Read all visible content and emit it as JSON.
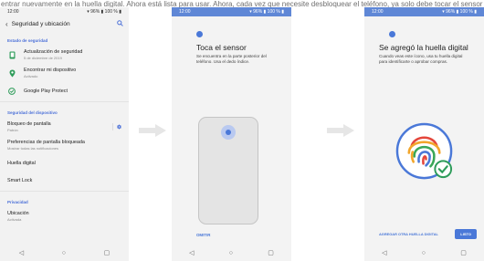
{
  "caption": "entrar nuevamente en la huella digital. Ahora está lista para usar. Ahora, cada vez que necesite desbloquear el teléfono, ya solo debe tocar el sensor de huellas. Asimismo, podrá hacer compras digitalmente y autorizar transacciones bancarias en la huella digital. Al final, ya puedes usar tu huella digital. Por último, el sistema te indica que ya puedes usar la huella digital para desbloquear tu teléfono y autorizar compras.",
  "panel1": {
    "status_time": "12:00",
    "status_right": "▾ 96% ▮ 100 % ▮",
    "title": "Seguridad y ubicación",
    "section_security_status": "Estado de seguridad",
    "items_status": [
      {
        "title": "Actualización de seguridad",
        "sub": "5 de diciembre de 2019",
        "icon": "phone-icon"
      },
      {
        "title": "Encontrar mi dispositivo",
        "sub": "Activado",
        "icon": "location-icon"
      },
      {
        "title": "Google Play Protect",
        "sub": "",
        "icon": "shield-icon"
      }
    ],
    "section_device_security": "Seguridad del dispositivo",
    "items_device": [
      {
        "title": "Bloqueo de pantalla",
        "sub": "Patrón"
      },
      {
        "title": "Preferencias de pantalla bloqueada",
        "sub": "Mostrar todas las notificaciones"
      },
      {
        "title": "Huella digital",
        "sub": ""
      },
      {
        "title": "Smart Lock",
        "sub": ""
      }
    ],
    "section_privacy": "Privacidad",
    "items_privacy": [
      {
        "title": "Ubicación",
        "sub": "Activada"
      }
    ]
  },
  "panel2": {
    "status_time": "12:00",
    "status_right": "▾ 96% ▮ 100 % ▮",
    "title": "Toca el sensor",
    "subtitle": "Se encuentra en la parte posterior del teléfono. Usa el dedo índice.",
    "skip_label": "OMITIR"
  },
  "panel3": {
    "status_time": "12:00",
    "status_right": "▾ 96% ▮ 100 % ▮",
    "title": "Se agregó la huella digital",
    "subtitle": "Cuando veas este ícono, usa tu huella digital para identificarte o aprobar compras.",
    "add_other_label": "AGREGAR OTRA HUELLA DIGITAL",
    "done_label": "LISTO"
  },
  "nav": {
    "back": "◁",
    "home": "○",
    "recents": "▢"
  },
  "colors": {
    "accent": "#4a78d8",
    "status_bar": "#5f87d6",
    "check": "#2e9c5a"
  }
}
